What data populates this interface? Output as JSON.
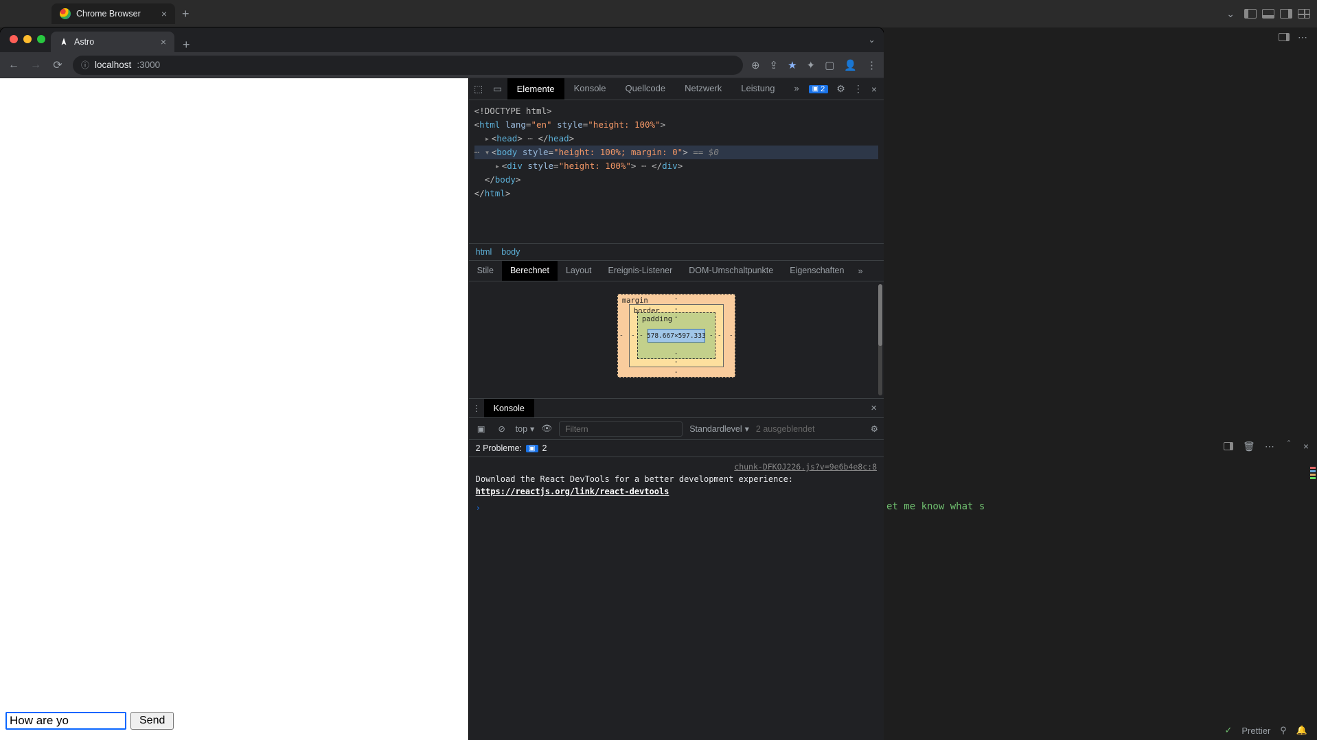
{
  "host": {
    "tab_title": "Chrome Browser"
  },
  "browser": {
    "tab_title": "Astro",
    "address_host": "localhost",
    "address_port": ":3000"
  },
  "page": {
    "chat_input_value": "How are yo",
    "send_label": "Send"
  },
  "devtools": {
    "tabs": [
      "Elemente",
      "Konsole",
      "Quellcode",
      "Netzwerk",
      "Leistung"
    ],
    "issue_badge": "2",
    "dom": {
      "l0": "<!DOCTYPE html>",
      "l1_open": "<html ",
      "l1_attr": "lang",
      "l1_val": "\"en\"",
      "l1_style": "style",
      "l1_styleval": "\"height: 100%\"",
      "l2": "<head>",
      "l2_close": "</head>",
      "l3_open": "<body ",
      "l3_style": "style",
      "l3_styleval": "\"height: 100%; margin: 0\"",
      "l3_sel": " == $0",
      "l4_open": "<div ",
      "l4_style": "style",
      "l4_styleval": "\"height: 100%\"",
      "l4_close": "</div>",
      "l5": "</body>",
      "l6": "</html>"
    },
    "crumbs": [
      "html",
      "body"
    ],
    "subtabs": [
      "Stile",
      "Berechnet",
      "Layout",
      "Ereignis-Listener",
      "DOM-Umschaltpunkte",
      "Eigenschaften"
    ],
    "boxmodel": {
      "margin_label": "margin",
      "border_label": "border",
      "padding_label": "padding",
      "content": "578.667×597.333",
      "dash": "-"
    }
  },
  "console": {
    "drawer_tab": "Konsole",
    "context": "top",
    "filter_placeholder": "Filtern",
    "level": "Standardlevel",
    "hidden": "2 ausgeblendet",
    "problems_label": "2 Probleme:",
    "problems_count": "2",
    "source": "chunk-DFKOJ226.js?v=9e6b4e8c:8",
    "msg_pre": "Download the React DevTools for a better development experience: ",
    "msg_link": "https://reactjs.org/link/react-devtools"
  },
  "editor": {
    "snippet": "et me know what s",
    "status_prettier": "Prettier"
  }
}
